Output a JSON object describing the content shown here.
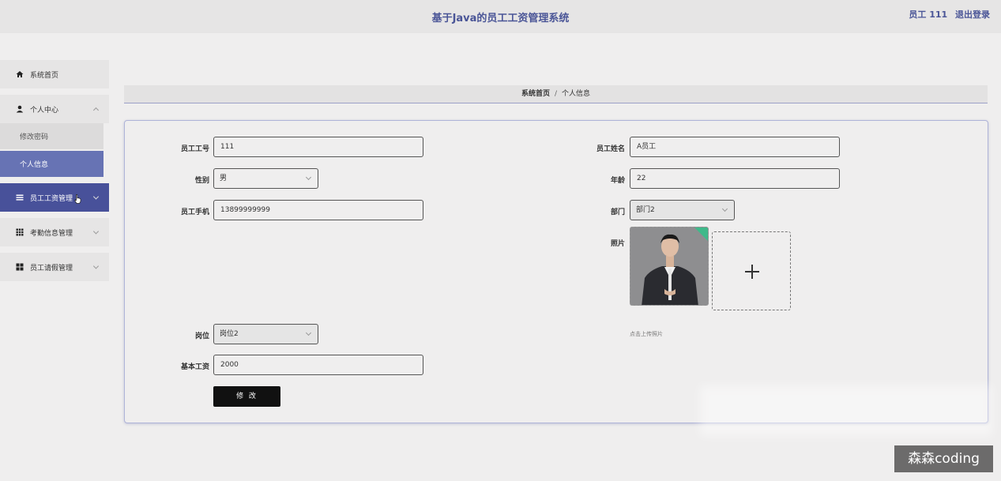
{
  "header": {
    "title": "基于Java的员工工资管理系统",
    "user_label": "员工 111",
    "logout_label": "退出登录"
  },
  "sidebar": {
    "items": [
      {
        "label": "系统首页",
        "icon": "home-icon"
      },
      {
        "label": "个人中心",
        "icon": "user-icon",
        "expanded": true,
        "children": [
          {
            "label": "修改密码"
          },
          {
            "label": "个人信息",
            "selected": true
          }
        ]
      },
      {
        "label": "员工工资管理",
        "icon": "list-icon",
        "active": true
      },
      {
        "label": "考勤信息管理",
        "icon": "grid-icon"
      },
      {
        "label": "员工请假管理",
        "icon": "apps-icon"
      }
    ]
  },
  "breadcrumb": {
    "home": "系统首页",
    "separator": "/",
    "current": "个人信息"
  },
  "form": {
    "employee_no": {
      "label": "员工工号",
      "value": "111"
    },
    "gender": {
      "label": "性别",
      "value": "男"
    },
    "phone": {
      "label": "员工手机",
      "value": "13899999999"
    },
    "name": {
      "label": "员工姓名",
      "value": "A员工"
    },
    "age": {
      "label": "年龄",
      "value": "22"
    },
    "department": {
      "label": "部门",
      "value": "部门2"
    },
    "photo": {
      "label": "照片",
      "hint": "点击上传照片"
    },
    "position": {
      "label": "岗位",
      "value": "岗位2"
    },
    "base_salary": {
      "label": "基本工资",
      "value": "2000"
    },
    "submit_label": "修 改"
  },
  "watermark": "森森coding",
  "colors": {
    "accent": "#48519a",
    "selected": "#6773b4",
    "button": "#111111",
    "upload_badge": "#3fb98a"
  }
}
